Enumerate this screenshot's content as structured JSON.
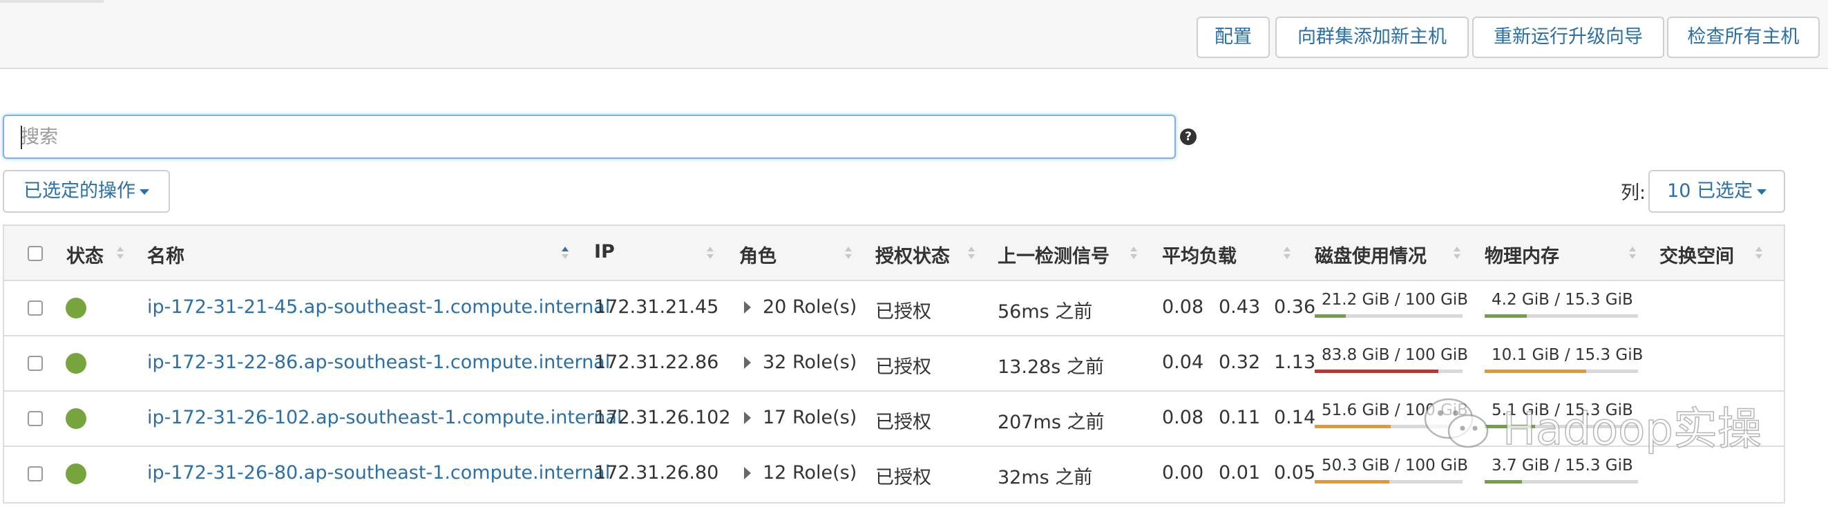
{
  "toolbar": {
    "buttons": {
      "config": "配置",
      "add_hosts": "向群集添加新主机",
      "rerun_upgrade": "重新运行升级向导",
      "inspect_all": "检查所有主机"
    }
  },
  "search": {
    "placeholder": "搜索",
    "help": "?"
  },
  "actions": {
    "selected_ops": "已选定的操作"
  },
  "columns_picker": {
    "label": "列:",
    "value": "10 已选定"
  },
  "table": {
    "headers": {
      "status": "状态",
      "name": "名称",
      "ip": "IP",
      "roles": "角色",
      "auth": "授权状态",
      "heartbeat": "上一检测信号",
      "load": "平均负载",
      "disk": "磁盘使用情况",
      "memory": "物理内存",
      "swap": "交换空间"
    },
    "rows": [
      {
        "status": "good",
        "name": "ip-172-31-21-45.ap-southeast-1.compute.internal",
        "ip": "172.31.21.45",
        "roles": "20 Role(s)",
        "auth": "已授权",
        "heartbeat": "56ms 之前",
        "load1": "0.08",
        "load5": "0.43",
        "load15": "0.36",
        "disk": "21.2 GiB / 100 GiB",
        "disk_pct": 21.2,
        "disk_color": "#6fa240",
        "mem": "4.2 GiB / 15.3 GiB",
        "mem_pct": 27.5,
        "mem_color": "#6fa240"
      },
      {
        "status": "good",
        "name": "ip-172-31-22-86.ap-southeast-1.compute.internal",
        "ip": "172.31.22.86",
        "roles": "32 Role(s)",
        "auth": "已授权",
        "heartbeat": "13.28s 之前",
        "load1": "0.04",
        "load5": "0.32",
        "load15": "1.13",
        "disk": "83.8 GiB / 100 GiB",
        "disk_pct": 83.8,
        "disk_color": "#c9302c",
        "mem": "10.1 GiB / 15.3 GiB",
        "mem_pct": 66,
        "mem_color": "#e39a2b"
      },
      {
        "status": "good",
        "name": "ip-172-31-26-102.ap-southeast-1.compute.internal",
        "ip": "172.31.26.102",
        "roles": "17 Role(s)",
        "auth": "已授权",
        "heartbeat": "207ms 之前",
        "load1": "0.08",
        "load5": "0.11",
        "load15": "0.14",
        "disk": "51.6 GiB / 100 GiB",
        "disk_pct": 51.6,
        "disk_color": "#e39a2b",
        "mem": "5.1 GiB / 15.3 GiB",
        "mem_pct": 33,
        "mem_color": "#6fa240"
      },
      {
        "status": "good",
        "name": "ip-172-31-26-80.ap-southeast-1.compute.internal",
        "ip": "172.31.26.80",
        "roles": "12 Role(s)",
        "auth": "已授权",
        "heartbeat": "32ms 之前",
        "load1": "0.00",
        "load5": "0.01",
        "load15": "0.05",
        "disk": "50.3 GiB / 100 GiB",
        "disk_pct": 50.3,
        "disk_color": "#e39a2b",
        "mem": "3.7 GiB / 15.3 GiB",
        "mem_pct": 24.2,
        "mem_color": "#6fa240"
      }
    ]
  },
  "watermark": {
    "text": "Hadoop实操"
  },
  "colors": {
    "accent": "#2a6fa8",
    "status_good": "#76a53d"
  }
}
